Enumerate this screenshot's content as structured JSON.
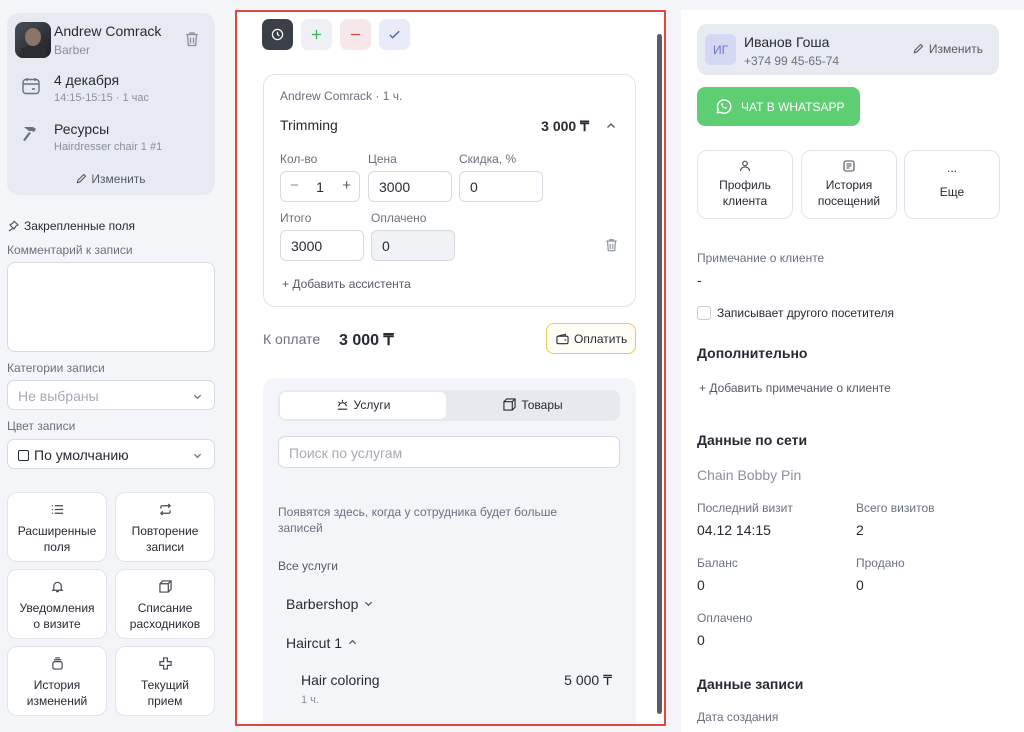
{
  "employee": {
    "name": "Andrew Comrack",
    "role": "Barber",
    "date": "4 декабря",
    "time": "14:15-15:15 · 1 час",
    "resources_label": "Ресурсы",
    "resource": "Hairdresser chair 1 #1",
    "edit_label": "Изменить"
  },
  "left": {
    "pinned_title": "Закрепленные поля",
    "comment_label": "Комментарий к записи",
    "categories_label": "Категории записи",
    "categories_placeholder": "Не выбраны",
    "color_label": "Цвет записи",
    "color_value": "По умолчанию",
    "tiles": [
      {
        "icon": "list-icon",
        "line1": "Расширенные",
        "line2": "поля"
      },
      {
        "icon": "repeat-icon",
        "line1": "Повторение",
        "line2": "записи"
      },
      {
        "icon": "bell-icon",
        "line1": "Уведомления",
        "line2": "о визите"
      },
      {
        "icon": "box-icon",
        "line1": "Списание",
        "line2": "расходников"
      },
      {
        "icon": "history-icon",
        "line1": "История",
        "line2": "изменений"
      },
      {
        "icon": "plus-cross-icon",
        "line1": "Текущий",
        "line2": "прием"
      }
    ]
  },
  "service": {
    "employee_line": "Andrew Comrack · 1 ч.",
    "name": "Trimming",
    "price": "3 000 ₸",
    "qty_label": "Кол-во",
    "qty": "1",
    "price_label": "Цена",
    "price_value": "3000",
    "discount_label": "Скидка, %",
    "discount_value": "0",
    "total_label": "Итого",
    "total_value": "3000",
    "paid_label": "Оплачено",
    "paid_value": "0",
    "add_assistant": "+ Добавить ассистента"
  },
  "payment": {
    "label": "К оплате",
    "sum": "3 000 ₸",
    "button": "Оплатить"
  },
  "catalog": {
    "tab_services": "Услуги",
    "tab_goods": "Товары",
    "search_placeholder": "Поиск по услугам",
    "hint": "Появятся здесь, когда у сотрудника будет больше записей",
    "all_services": "Все услуги",
    "group1": "Barbershop",
    "group2": "Haircut 1",
    "item_name": "Hair coloring",
    "item_duration": "1 ч.",
    "item_price": "5 000 ₸"
  },
  "client": {
    "initials": "ИГ",
    "name": "Иванов Гоша",
    "phone": "+374 99 45-65-74",
    "edit_label": "Изменить",
    "whatsapp": "ЧАТ В WHATSAPP",
    "tiles": [
      {
        "icon": "user-icon",
        "line1": "Профиль",
        "line2": "клиента"
      },
      {
        "icon": "document-icon",
        "line1": "История",
        "line2": "посещений"
      },
      {
        "icon": "more-icon",
        "line1": "...",
        "line2": "Еще"
      }
    ],
    "note_label": "Примечание о клиенте",
    "note_value": "-",
    "other_visitor": "Записывает другого посетителя",
    "extra_title": "Дополнительно",
    "add_note": "+ Добавить примечание о клиенте",
    "network_title": "Данные по сети",
    "network_name": "Chain Bobby Pin",
    "last_visit_label": "Последний визит",
    "last_visit": "04.12 14:15",
    "total_visits_label": "Всего визитов",
    "total_visits": "2",
    "balance_label": "Баланс",
    "balance": "0",
    "sold_label": "Продано",
    "sold": "0",
    "paid_label": "Оплачено",
    "paid": "0",
    "record_title": "Данные записи",
    "created_label": "Дата создания"
  }
}
